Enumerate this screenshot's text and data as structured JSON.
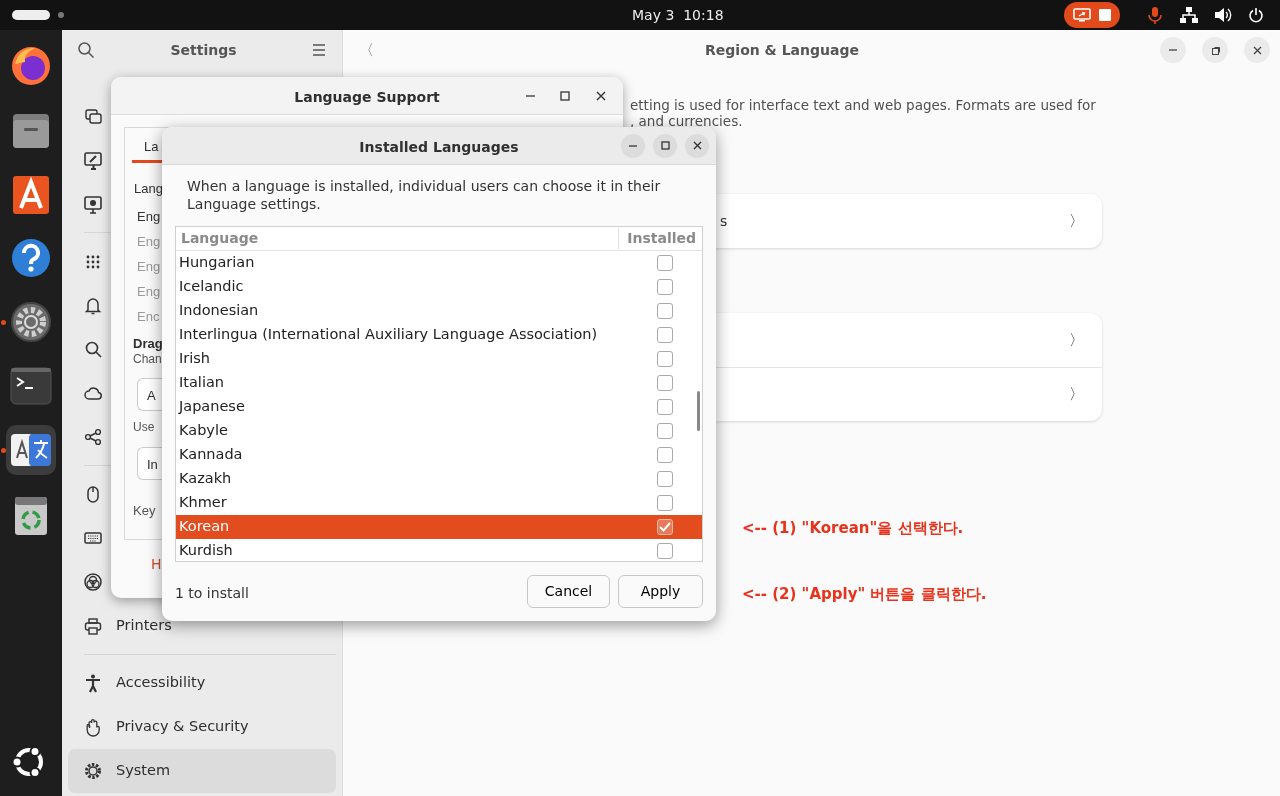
{
  "top_bar": {
    "clock": "May 3  10:18"
  },
  "dock": {
    "items": [
      {
        "running": false,
        "selected": false
      },
      {
        "running": false,
        "selected": false
      },
      {
        "running": false,
        "selected": false
      },
      {
        "running": false,
        "selected": false
      },
      {
        "running": true,
        "selected": false
      },
      {
        "running": false,
        "selected": false
      },
      {
        "running": true,
        "selected": true
      },
      {
        "running": false,
        "selected": false
      }
    ]
  },
  "settings": {
    "sidebar": {
      "title": "Settings",
      "groups": [
        {
          "items": [
            {
              "selected": false
            },
            {
              "selected": false
            },
            {
              "selected": false
            }
          ]
        },
        {
          "items": [
            {
              "selected": false
            },
            {
              "selected": false
            },
            {
              "selected": false
            },
            {
              "selected": false
            },
            {
              "selected": false
            }
          ]
        },
        {
          "items": [
            {
              "selected": false
            },
            {
              "selected": false
            },
            {
              "selected": false
            },
            {
              "label": "Printers",
              "selected": false
            }
          ]
        },
        {
          "items": [
            {
              "label": "Accessibility",
              "selected": false
            },
            {
              "label": "Privacy & Security",
              "selected": false
            },
            {
              "label": "System",
              "selected": true
            }
          ]
        }
      ]
    },
    "page": {
      "back": "〈",
      "title": "Region & Language",
      "description": [
        "etting is used for interface text and web pages. Formats are used for",
        ", and currencies."
      ],
      "cards": [
        {
          "rows": [
            {
              "label": "s",
              "chevron": "〉"
            }
          ]
        },
        {
          "rows": [
            {
              "chevron": "〉"
            },
            {
              "chevron": "〉"
            }
          ]
        }
      ]
    }
  },
  "language_support": {
    "title": "Language Support",
    "tabs": [
      {
        "label": "La",
        "selected": true
      }
    ],
    "section_label": "Lang",
    "languages": [
      {
        "label": "Eng",
        "dimmed": false
      },
      {
        "label": "Eng",
        "dimmed": true
      },
      {
        "label": "Eng",
        "dimmed": true
      },
      {
        "label": "Eng",
        "dimmed": true
      },
      {
        "label": "Enc",
        "dimmed": true
      }
    ],
    "drag_title": "Drag",
    "drag_hint": "Chan",
    "apply_button": "A",
    "use_label": "Use",
    "install_button": "In",
    "keyboard_label": "Key",
    "help_link": "H"
  },
  "installed_languages": {
    "title": "Installed Languages",
    "description": "When a language is installed, individual users can choose it in their Language settings.",
    "columns": [
      "Language",
      "Installed"
    ],
    "rows": [
      {
        "language": "Hungarian",
        "installed": false,
        "selected": false
      },
      {
        "language": "Icelandic",
        "installed": false,
        "selected": false
      },
      {
        "language": "Indonesian",
        "installed": false,
        "selected": false
      },
      {
        "language": "Interlingua (International Auxiliary Language Association)",
        "installed": false,
        "selected": false
      },
      {
        "language": "Irish",
        "installed": false,
        "selected": false
      },
      {
        "language": "Italian",
        "installed": false,
        "selected": false
      },
      {
        "language": "Japanese",
        "installed": false,
        "selected": false
      },
      {
        "language": "Kabyle",
        "installed": false,
        "selected": false
      },
      {
        "language": "Kannada",
        "installed": false,
        "selected": false
      },
      {
        "language": "Kazakh",
        "installed": false,
        "selected": false
      },
      {
        "language": "Khmer",
        "installed": false,
        "selected": false
      },
      {
        "language": "Korean",
        "installed": true,
        "selected": true
      },
      {
        "language": "Kurdish",
        "installed": false,
        "selected": false
      }
    ],
    "status": "1 to install",
    "buttons": [
      "Cancel",
      "Apply"
    ]
  },
  "annotations": [
    {
      "text": "<-- (1)  \"Korean\"을 선택한다."
    },
    {
      "text": "<-- (2)  \"Apply\" 버튼을 클릭한다."
    }
  ]
}
